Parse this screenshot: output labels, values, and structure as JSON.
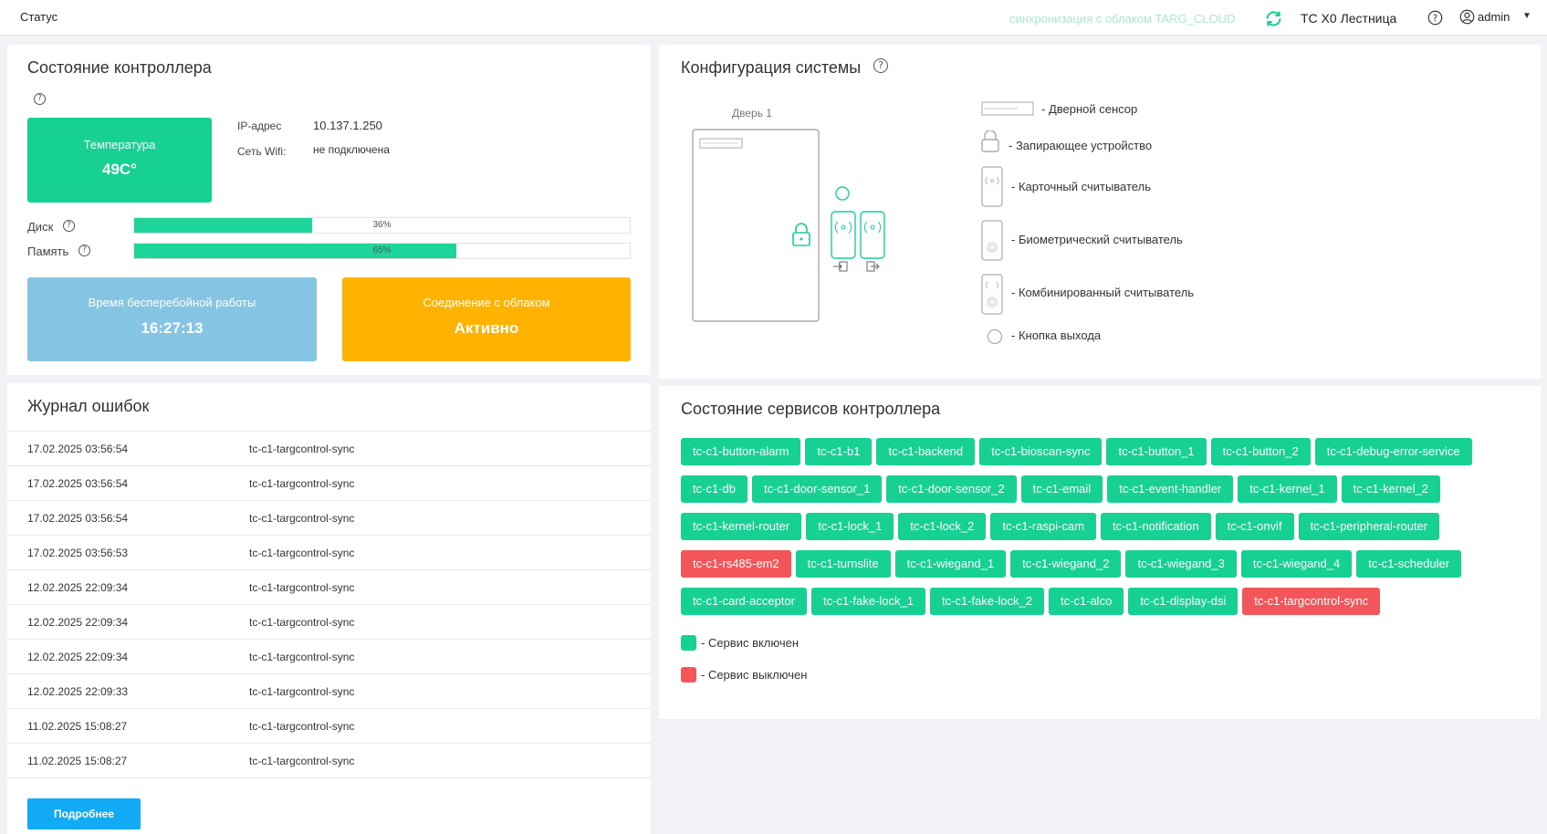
{
  "header": {
    "title": "Статус",
    "sync_text": "синхронизация с облаком TARG_CLOUD",
    "device": "TC X0 Лестница",
    "user": "admin"
  },
  "controller": {
    "title": "Состояние контроллера",
    "temperature_label": "Температура",
    "temperature_value": "49C°",
    "ip_label": "IP-адрес",
    "ip_value": "10.137.1.250",
    "wifi_label": "Сеть Wifi:",
    "wifi_value": "не подключена",
    "disk_label": "Диск",
    "disk_percent": 36,
    "disk_text": "36%",
    "memory_label": "Память",
    "memory_percent": 65,
    "memory_text": "65%",
    "uptime_label": "Время бесперебойной работы",
    "uptime_value": "16:27:13",
    "cloud_label": "Соединение с облаком",
    "cloud_value": "Активно"
  },
  "config": {
    "title": "Конфигурация системы",
    "door_label": "Дверь 1",
    "legend": [
      "- Дверной сенсор",
      "- Запирающее устройство",
      "- Карточный считыватель",
      "- Биометрический считыватель",
      "- Комбинированный считыватель",
      "- Кнопка выхода"
    ]
  },
  "errors": {
    "title": "Журнал ошибок",
    "rows": [
      {
        "date": "17.02.2025 03:56:54",
        "service": "tc-c1-targcontrol-sync"
      },
      {
        "date": "17.02.2025 03:56:54",
        "service": "tc-c1-targcontrol-sync"
      },
      {
        "date": "17.02.2025 03:56:54",
        "service": "tc-c1-targcontrol-sync"
      },
      {
        "date": "17.02.2025 03:56:53",
        "service": "tc-c1-targcontrol-sync"
      },
      {
        "date": "12.02.2025 22:09:34",
        "service": "tc-c1-targcontrol-sync"
      },
      {
        "date": "12.02.2025 22:09:34",
        "service": "tc-c1-targcontrol-sync"
      },
      {
        "date": "12.02.2025 22:09:34",
        "service": "tc-c1-targcontrol-sync"
      },
      {
        "date": "12.02.2025 22:09:33",
        "service": "tc-c1-targcontrol-sync"
      },
      {
        "date": "11.02.2025 15:08:27",
        "service": "tc-c1-targcontrol-sync"
      },
      {
        "date": "11.02.2025 15:08:27",
        "service": "tc-c1-targcontrol-sync"
      }
    ],
    "more_button": "Подробнее"
  },
  "services": {
    "title": "Состояние сервисов контроллера",
    "rows": [
      [
        {
          "name": "tc-c1-button-alarm",
          "on": true
        },
        {
          "name": "tc-c1-b1",
          "on": true
        },
        {
          "name": "tc-c1-backend",
          "on": true
        },
        {
          "name": "tc-c1-bioscan-sync",
          "on": true
        },
        {
          "name": "tc-c1-button_1",
          "on": true
        },
        {
          "name": "tc-c1-button_2",
          "on": true
        },
        {
          "name": "tc-c1-debug-error-service",
          "on": true
        }
      ],
      [
        {
          "name": "tc-c1-db",
          "on": true
        },
        {
          "name": "tc-c1-door-sensor_1",
          "on": true
        },
        {
          "name": "tc-c1-door-sensor_2",
          "on": true
        },
        {
          "name": "tc-c1-email",
          "on": true
        },
        {
          "name": "tc-c1-event-handler",
          "on": true
        },
        {
          "name": "tc-c1-kernel_1",
          "on": true
        },
        {
          "name": "tc-c1-kernel_2",
          "on": true
        }
      ],
      [
        {
          "name": "tc-c1-kernel-router",
          "on": true
        },
        {
          "name": "tc-c1-lock_1",
          "on": true
        },
        {
          "name": "tc-c1-lock_2",
          "on": true
        },
        {
          "name": "tc-c1-raspi-cam",
          "on": true
        },
        {
          "name": "tc-c1-notification",
          "on": true
        },
        {
          "name": "tc-c1-onvif",
          "on": true
        },
        {
          "name": "tc-c1-peripheral-router",
          "on": true
        }
      ],
      [
        {
          "name": "tc-c1-rs485-em2",
          "on": false
        },
        {
          "name": "tc-c1-turnslite",
          "on": true
        },
        {
          "name": "tc-c1-wiegand_1",
          "on": true
        },
        {
          "name": "tc-c1-wiegand_2",
          "on": true
        },
        {
          "name": "tc-c1-wiegand_3",
          "on": true
        },
        {
          "name": "tc-c1-wiegand_4",
          "on": true
        },
        {
          "name": "tc-c1-scheduler",
          "on": true
        }
      ],
      [
        {
          "name": "tc-c1-card-acceptor",
          "on": true
        },
        {
          "name": "tc-c1-fake-lock_1",
          "on": true
        },
        {
          "name": "tc-c1-fake-lock_2",
          "on": true
        },
        {
          "name": "tc-c1-alco",
          "on": true
        },
        {
          "name": "tc-c1-display-dsi",
          "on": true
        },
        {
          "name": "tc-c1-targcontrol-sync",
          "on": false
        }
      ]
    ],
    "legend_on": "- Сервис включен",
    "legend_off": "- Сервис выключен"
  },
  "colors": {
    "green": "#17d193",
    "red": "#f2565a",
    "blue_tile": "#86c4e3",
    "orange_tile": "#ffb300",
    "button_blue": "#13aaf5"
  }
}
